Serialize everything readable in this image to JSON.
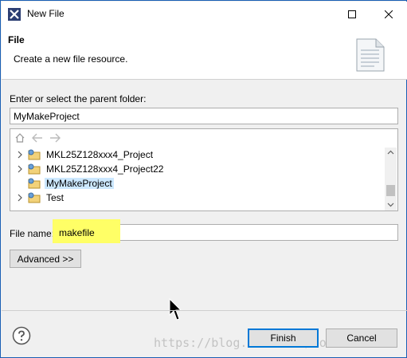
{
  "window": {
    "title": "New File"
  },
  "header": {
    "title": "File",
    "description": "Create a new file resource."
  },
  "parent_folder": {
    "label": "Enter or select the parent folder:",
    "value": "MyMakeProject"
  },
  "tree": {
    "items": [
      {
        "label": "MKL25Z128xxx4_Project",
        "expandable": true,
        "selected": false
      },
      {
        "label": "MKL25Z128xxx4_Project22",
        "expandable": true,
        "selected": false
      },
      {
        "label": "MyMakeProject",
        "expandable": false,
        "selected": true
      },
      {
        "label": "Test",
        "expandable": true,
        "selected": false
      }
    ]
  },
  "file_name": {
    "label": "File name:",
    "value": "makefile",
    "highlight_color": "#ffff66"
  },
  "buttons": {
    "advanced": "Advanced >>",
    "finish": "Finish",
    "cancel": "Cancel"
  },
  "watermark": "https://blog.csdn.net/foxclever",
  "colors": {
    "selection": "#cce8ff",
    "accent": "#0078d7",
    "help": "#1a5fb4"
  }
}
